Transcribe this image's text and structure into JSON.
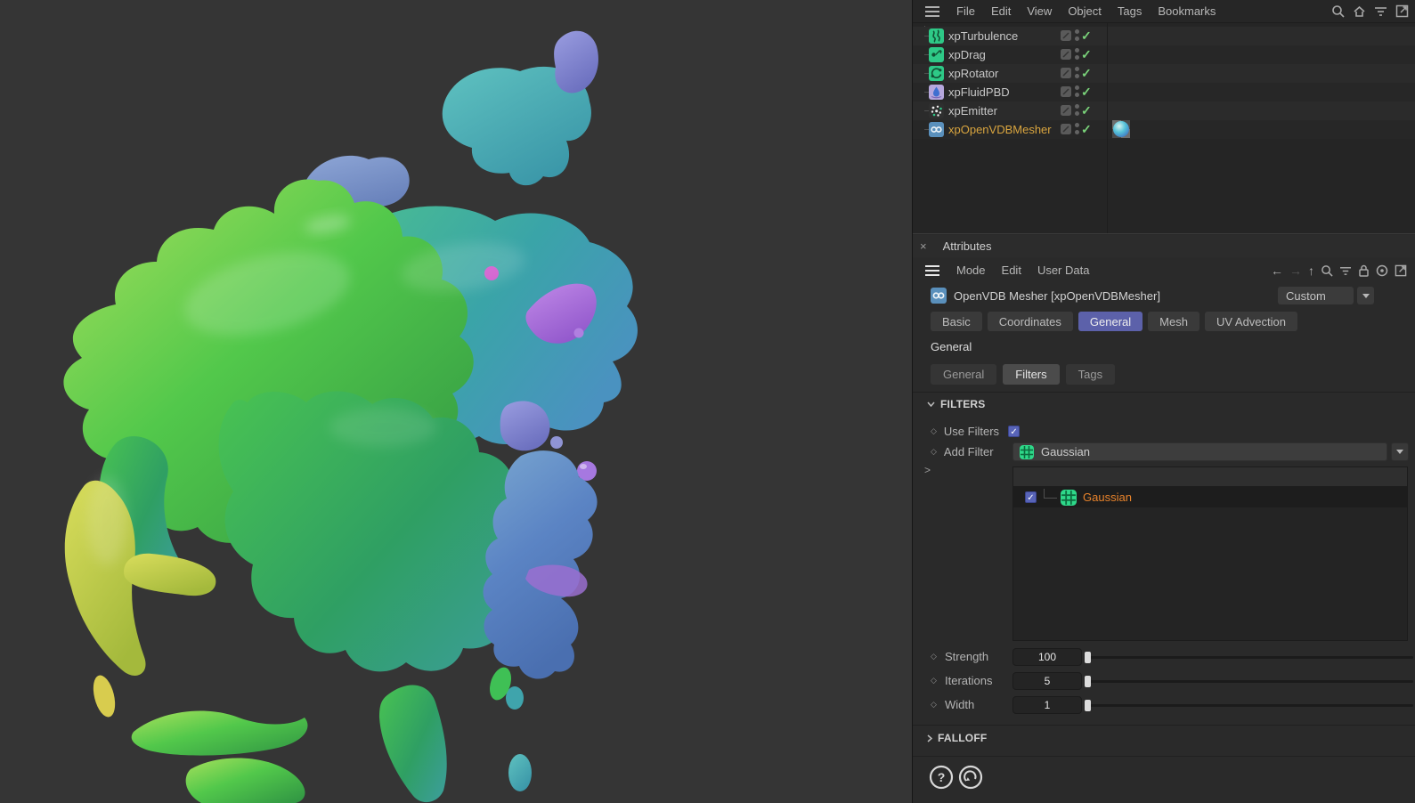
{
  "om_menu": {
    "items": [
      "File",
      "Edit",
      "View",
      "Object",
      "Tags",
      "Bookmarks"
    ],
    "icons": [
      "menu-icon",
      "search-icon",
      "home-icon",
      "filter-icon",
      "new-window-icon"
    ]
  },
  "object_manager": {
    "items": [
      {
        "name": "xpTurbulence",
        "icon": "turbulence-icon",
        "enabled_glyph": "✓"
      },
      {
        "name": "xpDrag",
        "icon": "drag-icon",
        "enabled_glyph": "✓"
      },
      {
        "name": "xpRotator",
        "icon": "rotator-icon",
        "enabled_glyph": "✓"
      },
      {
        "name": "xpFluidPBD",
        "icon": "fluid-icon",
        "enabled_glyph": "✓"
      },
      {
        "name": "xpEmitter",
        "icon": "emitter-icon",
        "enabled_glyph": "✓"
      },
      {
        "name": "xpOpenVDBMesher",
        "icon": "openvdb-mesher-icon",
        "enabled_glyph": "✓",
        "selected": true,
        "has_material_thumbnail": true
      }
    ]
  },
  "attributes": {
    "panel_title": "Attributes",
    "close_glyph": "×",
    "menu": {
      "items": [
        "Mode",
        "Edit",
        "User Data"
      ],
      "icons": [
        "back-icon",
        "forward-icon",
        "up-icon",
        "search-icon",
        "filter-icon",
        "lock-icon",
        "target-icon",
        "new-window-icon"
      ],
      "back_glyph": "←",
      "forward_glyph": "→",
      "up_glyph": "↑"
    },
    "object_title": "OpenVDB Mesher [xpOpenVDBMesher]",
    "preset_dropdown": "Custom",
    "tabs": [
      {
        "label": "Basic"
      },
      {
        "label": "Coordinates"
      },
      {
        "label": "General",
        "selected": true
      },
      {
        "label": "Mesh"
      },
      {
        "label": "UV Advection"
      }
    ],
    "section_label": "General",
    "subtabs": [
      {
        "label": "General"
      },
      {
        "label": "Filters",
        "selected": true
      },
      {
        "label": "Tags"
      }
    ],
    "filters": {
      "header": "FILTERS",
      "use_filters": {
        "label": "Use Filters",
        "checked": true,
        "check_glyph": "✓"
      },
      "add_filter": {
        "label": "Add Filter",
        "value": "Gaussian",
        "icon": "gaussian-filter-icon"
      },
      "filter_list": [
        {
          "name": "Gaussian",
          "checked": true,
          "check_glyph": "✓",
          "icon": "gaussian-filter-icon"
        }
      ],
      "sliders": [
        {
          "label": "Strength",
          "value": "100",
          "fill_style": "width:99.4%",
          "modified": false
        },
        {
          "label": "Iterations",
          "value": "5",
          "fill_style": "width:38.4%",
          "modified": true
        },
        {
          "label": "Width",
          "value": "1",
          "fill_style": "width:1%",
          "modified": false
        }
      ]
    },
    "falloff": {
      "header": "FALLOFF"
    },
    "footer_icons": [
      "help-icon",
      "reset-icon"
    ]
  },
  "colors": {
    "selected_tab": "#5c61aa",
    "checkbox_blue": "#5864b8",
    "slider_fill": "#5b62a8",
    "modified_orange": "#e0872e",
    "selected_object_text": "#d9a53f",
    "enabled_check_green": "#7ad37a",
    "viewport_background": "#353535"
  }
}
